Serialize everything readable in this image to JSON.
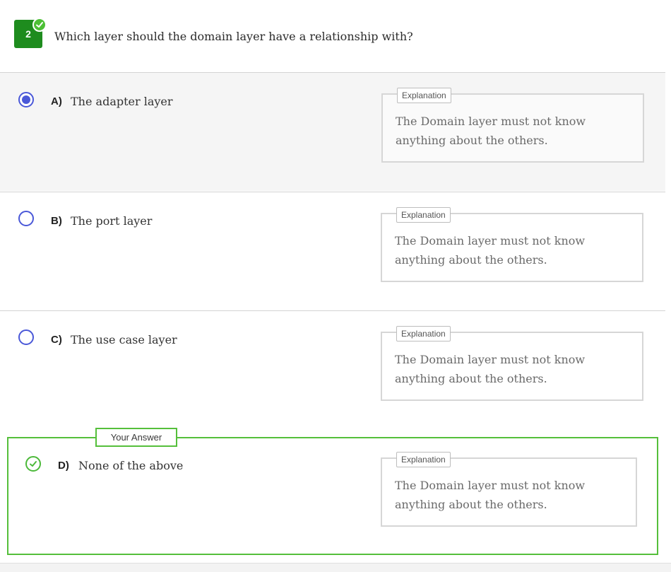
{
  "question": {
    "number": "2",
    "text": "Which layer should the domain layer have a relationship with?"
  },
  "options": [
    {
      "letter": "A)",
      "text": "The adapter layer",
      "selected": true,
      "explanation_tag": "Explanation",
      "explanation": "The Domain layer must not know anything about the others."
    },
    {
      "letter": "B)",
      "text": "The port layer",
      "selected": false,
      "explanation_tag": "Explanation",
      "explanation": "The Domain layer must not know anything about the others."
    },
    {
      "letter": "C)",
      "text": "The use case layer",
      "selected": false,
      "explanation_tag": "Explanation",
      "explanation": "The Domain layer must not know anything about the others."
    },
    {
      "letter": "D)",
      "text": "None of the above",
      "selected": false,
      "correct": true,
      "explanation_tag": "Explanation",
      "explanation": "The Domain layer must not know anything about the others."
    }
  ],
  "your_answer_label": "Your Answer",
  "colors": {
    "badge": "#1e8c1e",
    "correct": "#55bf3b",
    "radio": "#4a58d8",
    "selected_bg": "#f5f5f5"
  }
}
